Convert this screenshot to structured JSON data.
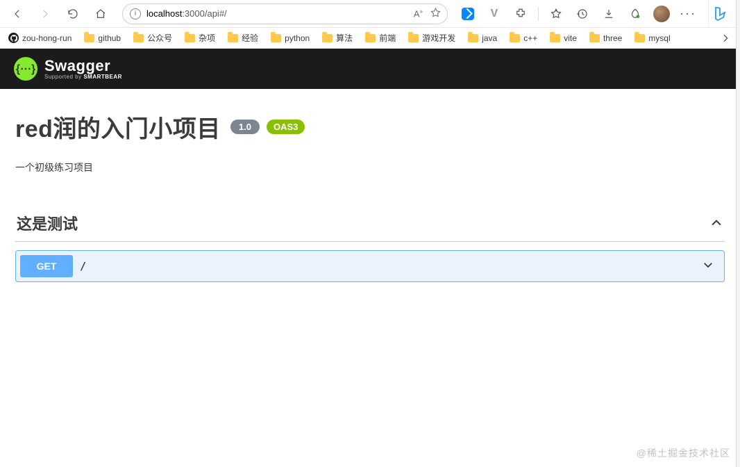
{
  "browser": {
    "url_host": "localhost",
    "url_port": ":3000",
    "url_path": "/api#/",
    "aa_label": "A",
    "aa_sup": "»"
  },
  "bookmarks": [
    {
      "type": "github",
      "label": "zou-hong-run"
    },
    {
      "type": "folder",
      "label": "github"
    },
    {
      "type": "folder",
      "label": "公众号"
    },
    {
      "type": "folder",
      "label": "杂项"
    },
    {
      "type": "folder",
      "label": "经验"
    },
    {
      "type": "folder",
      "label": "python"
    },
    {
      "type": "folder",
      "label": "算法"
    },
    {
      "type": "folder",
      "label": "前端"
    },
    {
      "type": "folder",
      "label": "游戏开发"
    },
    {
      "type": "folder",
      "label": "java"
    },
    {
      "type": "folder",
      "label": "c++"
    },
    {
      "type": "folder",
      "label": "vite"
    },
    {
      "type": "folder",
      "label": "three"
    },
    {
      "type": "folder",
      "label": "mysql"
    }
  ],
  "swagger": {
    "brand": "Swagger",
    "badge": "{⋯}",
    "supported_prefix": "Supported by ",
    "supported_brand": "SMARTBEAR"
  },
  "api": {
    "title": "red润的入门小项目",
    "version": "1.0",
    "oas": "OAS3",
    "description": "一个初级练习项目"
  },
  "tag": {
    "name": "这是测试"
  },
  "operation": {
    "method": "GET",
    "path": "/"
  },
  "watermark": "@稀土掘金技术社区"
}
